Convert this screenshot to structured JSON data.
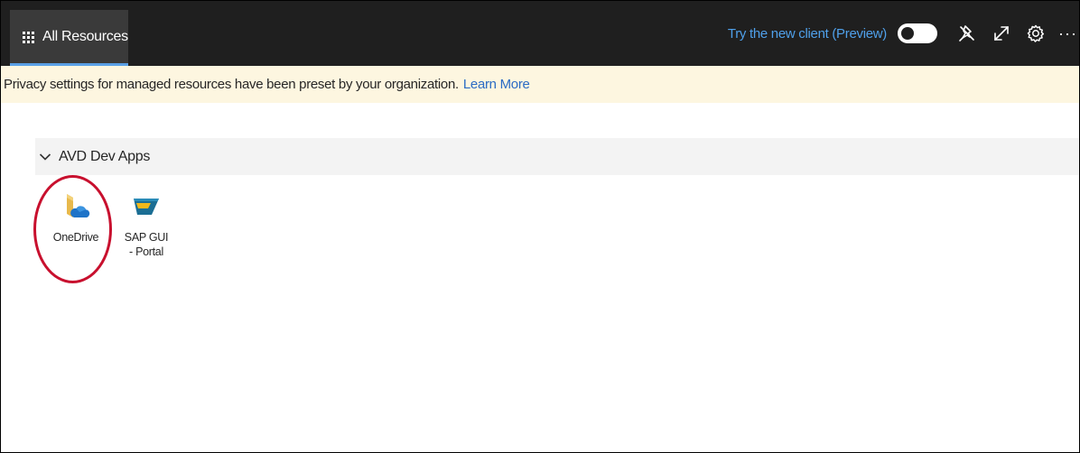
{
  "header": {
    "tab_label": "All Resources",
    "try_new_client": "Try the new client (Preview)",
    "toggle_state": "off",
    "icons": [
      "pin-icon",
      "expand-icon",
      "gear-icon",
      "more-icon"
    ],
    "more_label": "···"
  },
  "banner": {
    "message": "Privacy settings for managed resources have been preset by your organization.",
    "link_text": "Learn More"
  },
  "group": {
    "title": "AVD Dev Apps",
    "expanded": true,
    "apps": [
      {
        "label": "OneDrive",
        "icon": "onedrive-icon",
        "highlighted": true
      },
      {
        "label": "SAP GUI - Portal",
        "icon": "sap-gui-icon",
        "highlighted": false
      }
    ]
  },
  "colors": {
    "topbar": "#1f1f1f",
    "tab_active": "#3a3a3a",
    "tab_underline": "#5aa0e6",
    "link": "#4fa0ea",
    "banner_bg": "#fdf6e0",
    "group_header_bg": "#f3f3f3",
    "highlight": "#c8102e"
  }
}
